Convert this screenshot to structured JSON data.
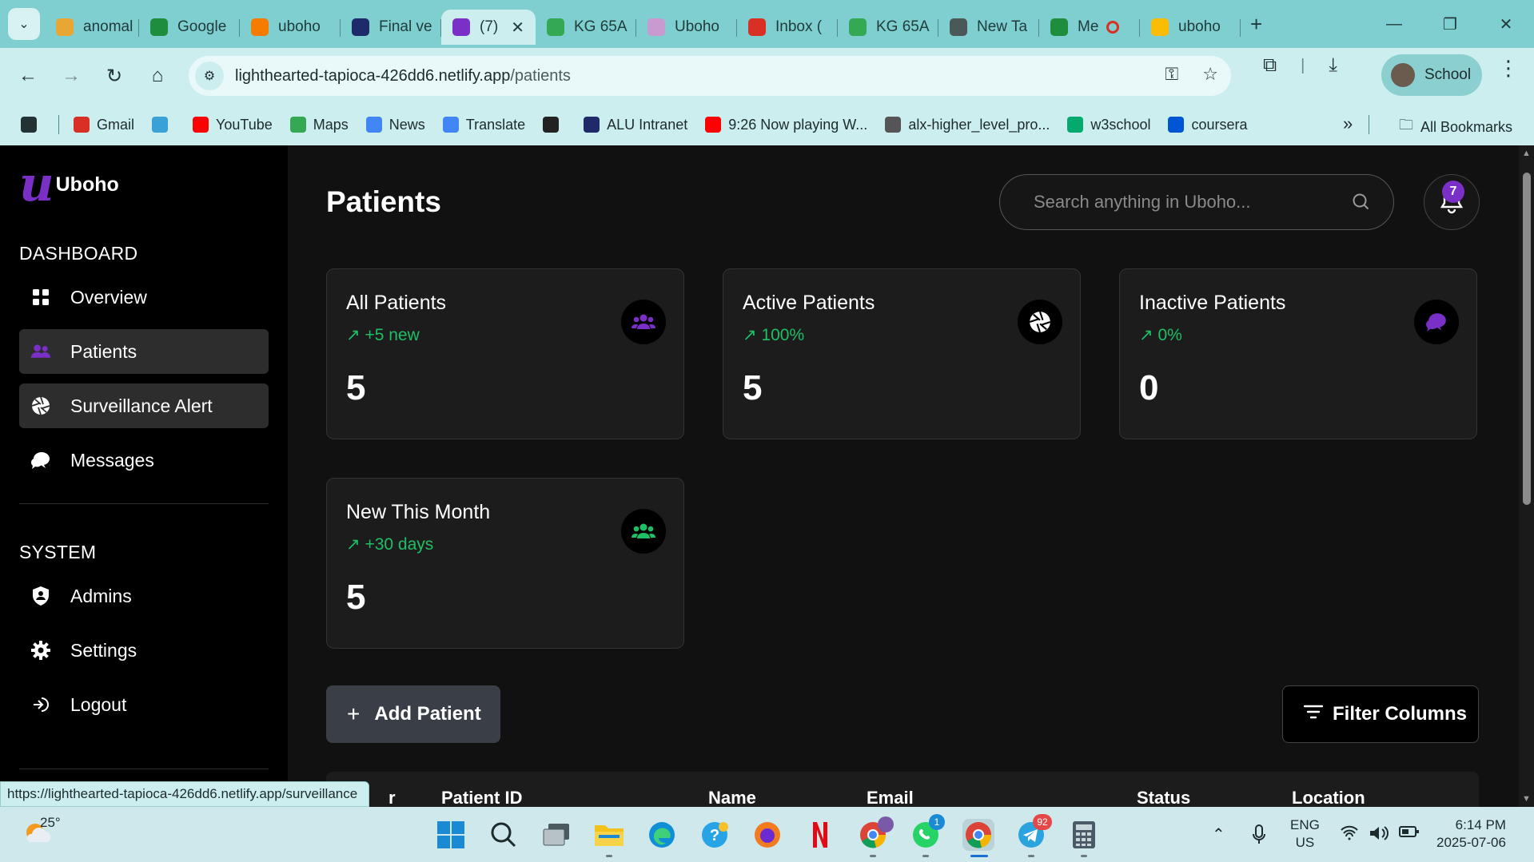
{
  "browser": {
    "tabs": [
      {
        "label": "anomal",
        "icon": "folder-icon",
        "color": "#e8a735"
      },
      {
        "label": "Google",
        "icon": "sheets-icon",
        "color": "#1e8e3e"
      },
      {
        "label": "uboho",
        "icon": "firebase-icon",
        "color": "#f57c00"
      },
      {
        "label": "Final ve",
        "icon": "alu-icon",
        "color": "#1f2a6b"
      },
      {
        "label": "(7)",
        "icon": "v-logo-icon",
        "color": "#7a2fc7",
        "active": true
      },
      {
        "label": "KG 65A",
        "icon": "maps-pin-icon",
        "color": "#34a853"
      },
      {
        "label": "Uboho",
        "icon": "uboho-faded-icon",
        "color": "#c99ad0"
      },
      {
        "label": "Inbox (",
        "icon": "gmail-icon",
        "color": "#d93025"
      },
      {
        "label": "KG 65A",
        "icon": "maps-pin-icon",
        "color": "#34a853"
      },
      {
        "label": "New Ta",
        "icon": "chrome-icon",
        "color": "#4b5858"
      },
      {
        "label": "Me",
        "icon": "meet-icon",
        "color": "#1e8e3e",
        "recording": true
      },
      {
        "label": "uboho",
        "icon": "drive-icon",
        "color": "#fbbc04"
      }
    ],
    "new_tab": "+",
    "url_host": "lighthearted-tapioca-426dd6.netlify.app",
    "url_path": "/patients",
    "profile_label": "School",
    "bookmarks": [
      {
        "label": "",
        "icon": "apps-grid-icon",
        "color": "#233333"
      },
      {
        "label": "Gmail",
        "icon": "gmail-icon",
        "color": "#d93025"
      },
      {
        "label": "",
        "icon": "cube-icon",
        "color": "#3aa0d8"
      },
      {
        "label": "YouTube",
        "icon": "youtube-icon",
        "color": "#ff0000"
      },
      {
        "label": "Maps",
        "icon": "maps-pin-icon",
        "color": "#34a853"
      },
      {
        "label": "News",
        "icon": "news-icon",
        "color": "#4285f4"
      },
      {
        "label": "Translate",
        "icon": "translate-icon",
        "color": "#4285f4"
      },
      {
        "label": "",
        "icon": "globe-icon",
        "color": "#222222"
      },
      {
        "label": "ALU Intranet",
        "icon": "alu-icon",
        "color": "#1f2a6b"
      },
      {
        "label": "9:26 Now playing W...",
        "icon": "youtube-icon",
        "color": "#ff0000"
      },
      {
        "label": "alx-higher_level_pro...",
        "icon": "github-icon",
        "color": "#555555"
      },
      {
        "label": "w3school",
        "icon": "w3-icon",
        "color": "#04aa6d"
      },
      {
        "label": "coursera",
        "icon": "coursera-icon",
        "color": "#0056d2"
      }
    ],
    "bookmarks_more": "»",
    "all_bookmarks": "All Bookmarks",
    "status_link": "https://lighthearted-tapioca-426dd6.netlify.app/surveillance"
  },
  "app": {
    "brand": "Uboho",
    "brand_mark": "u",
    "sections": {
      "dashboard": "DASHBOARD",
      "system": "SYSTEM"
    },
    "nav": {
      "overview": "Overview",
      "patients": "Patients",
      "surveillance": "Surveillance Alert",
      "messages": "Messages",
      "admins": "Admins",
      "settings": "Settings",
      "logout": "Logout"
    },
    "page_title": "Patients",
    "search_placeholder": "Search anything in Uboho...",
    "notification_count": "7",
    "cards": {
      "all": {
        "title": "All Patients",
        "delta": "+5 new",
        "value": "5",
        "icon_color": "#7a2fc7"
      },
      "active": {
        "title": "Active Patients",
        "delta": "100%",
        "value": "5",
        "icon_color": "#ffffff"
      },
      "inactive": {
        "title": "Inactive Patients",
        "delta": "0%",
        "value": "0",
        "icon_color": "#7a2fc7"
      },
      "new_month": {
        "title": "New This Month",
        "delta": "+30 days",
        "value": "5",
        "icon_color": "#1fbf66"
      }
    },
    "delta_arrow": "↗",
    "add_patient": "Add Patient",
    "filter_columns": "Filter Columns",
    "table_headers": [
      "r",
      "Patient ID",
      "Name",
      "Email",
      "Status",
      "Location"
    ]
  },
  "taskbar": {
    "temperature": "25°",
    "language": "ENG",
    "region": "US",
    "time": "6:14 PM",
    "date": "2025-07-06",
    "badges": {
      "whatsapp": "1",
      "telegram": "92"
    }
  },
  "colors": {
    "accent": "#7a2fc7",
    "positive": "#1fbf66",
    "browser_frame": "#7fcfd0",
    "browser_toolbar": "#cdeeee"
  }
}
